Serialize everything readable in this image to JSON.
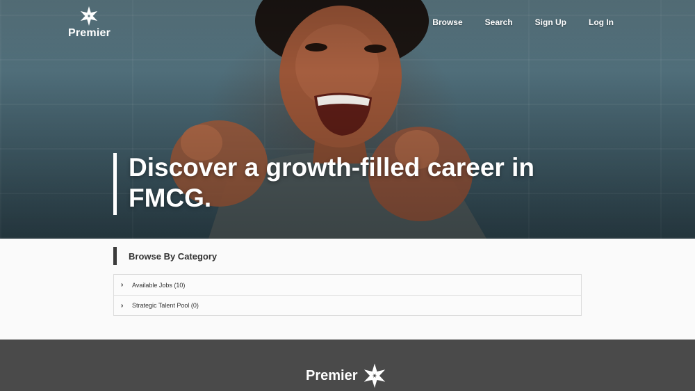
{
  "brand": {
    "name": "Premier",
    "logo_icon": "premier-star-icon"
  },
  "nav": {
    "items": [
      {
        "label": "Browse"
      },
      {
        "label": "Search"
      },
      {
        "label": "Sign Up"
      },
      {
        "label": "Log In"
      }
    ]
  },
  "hero": {
    "headline_line1": "Discover a growth-filled career in",
    "headline_line2": "FMCG."
  },
  "categories": {
    "title": "Browse By Category",
    "items": [
      {
        "label": "Available Jobs (10)",
        "icon": "chevron-right-icon"
      },
      {
        "label": "Strategic Talent Pool (0)",
        "icon": "chevron-right-icon"
      }
    ]
  },
  "footer": {
    "brand": "Premier"
  },
  "colors": {
    "footer_bg": "#4a4a4a",
    "accent_bar": "#3b3b3b",
    "hero_text": "#ffffff"
  }
}
